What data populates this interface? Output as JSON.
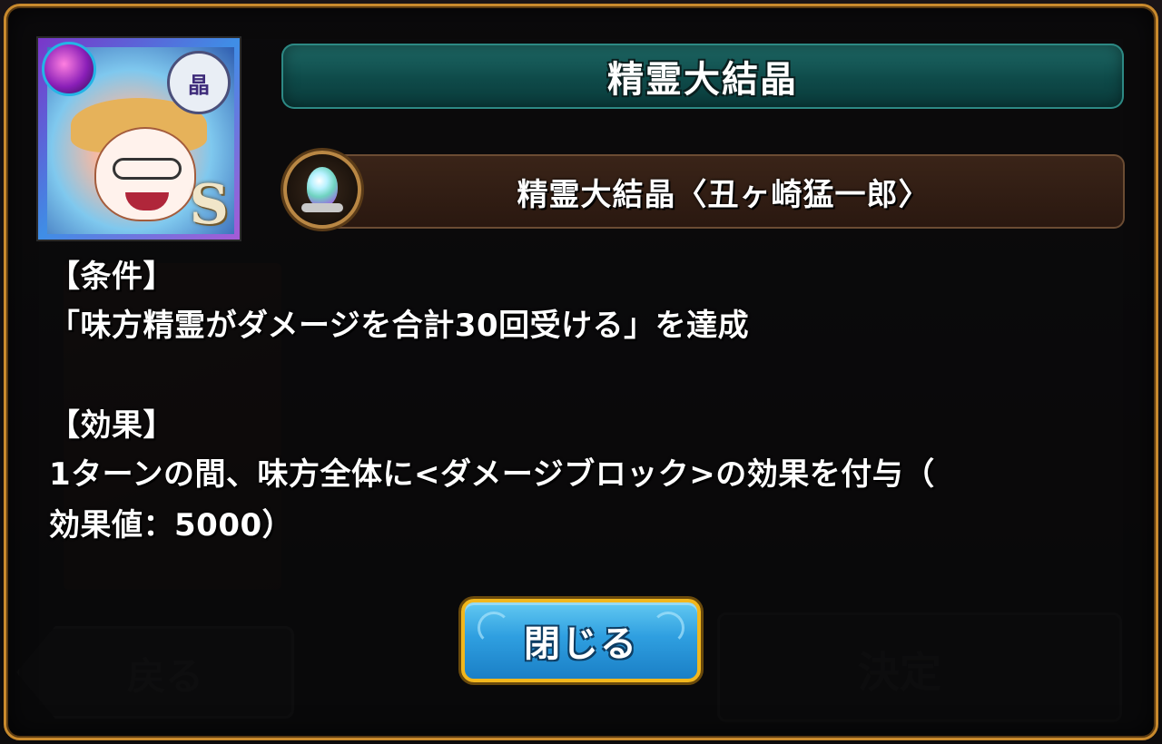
{
  "background": {
    "back_label": "戻る",
    "confirm_label": "決定"
  },
  "dialog": {
    "title": "精霊大結晶",
    "item_name": "精霊大結晶〈丑ヶ崎猛一郎〉",
    "portrait": {
      "class_badge": "晶",
      "rank": "S",
      "element_icon": "dark-element-icon"
    },
    "condition_heading": "【条件】",
    "condition_text": "「味方精霊がダメージを合計30回受ける」を達成",
    "effect_heading": "【効果】",
    "effect_line1": "1ターンの間、味方全体に<ダメージブロック>の効果を付与（",
    "effect_line2": "効果値：5000）",
    "close_label": "閉じる"
  },
  "colors": {
    "frame": "#c98a2d",
    "title_bar": "#0e4a49",
    "button_fill": "#2f9fe0",
    "button_border": "#f2b71d"
  }
}
